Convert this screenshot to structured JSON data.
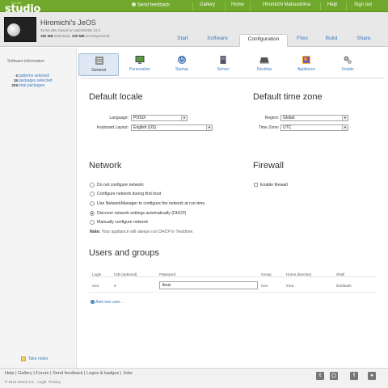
{
  "brand": {
    "small": "SUSE",
    "name": "studio"
  },
  "topnav": {
    "send_feedback": "Send feedback",
    "gallery": "Gallery",
    "home": "Home",
    "user": "Hiromichi Matsushima",
    "help": "Help",
    "sign_out": "Sign out"
  },
  "app": {
    "title": "Hiromichi's JeOS",
    "subtitle": "32-bit x86, based on openSUSE 12.2",
    "download_size": "180 MB",
    "download_label": "download,",
    "uncompressed_size": "336 MB",
    "uncompressed_label": "uncompressed"
  },
  "tabs": [
    {
      "label": "Start"
    },
    {
      "label": "Software"
    },
    {
      "label": "Configuration"
    },
    {
      "label": "Files"
    },
    {
      "label": "Build"
    },
    {
      "label": "Share"
    }
  ],
  "sidebar": {
    "title": "Software information",
    "stats": [
      {
        "num": "0",
        "label": "patterns selected"
      },
      {
        "num": "15",
        "label": "packages selected"
      },
      {
        "num": "225",
        "label": "total packages"
      }
    ],
    "take_notes": "Take notes"
  },
  "config_sections": [
    {
      "label": "General",
      "icon": "general-icon"
    },
    {
      "label": "Personalize",
      "icon": "personalize-icon"
    },
    {
      "label": "Startup",
      "icon": "startup-icon"
    },
    {
      "label": "Server",
      "icon": "server-icon"
    },
    {
      "label": "Desktop",
      "icon": "desktop-icon"
    },
    {
      "label": "Appliance",
      "icon": "appliance-icon"
    },
    {
      "label": "Scripts",
      "icon": "scripts-icon"
    }
  ],
  "locale": {
    "heading": "Default locale",
    "language_label": "Language:",
    "language_value": "POSIX",
    "keyboard_label": "Keyboard Layout:",
    "keyboard_value": "English (US)"
  },
  "timezone": {
    "heading": "Default time zone",
    "region_label": "Region:",
    "region_value": "Global",
    "tz_label": "Time Zone:",
    "tz_value": "UTC"
  },
  "network": {
    "heading": "Network",
    "options": [
      {
        "label": "Do not configure network"
      },
      {
        "label": "Configure network during first boot"
      },
      {
        "label": "Use NetworkManager to configure the network at run-time"
      },
      {
        "label": "Discover network settings automatically (DHCP)"
      },
      {
        "label": "Manually configure network"
      }
    ],
    "selected_index": 3,
    "note_label": "Note:",
    "note_text": "Your appliance will always run DHCP in Testdrive."
  },
  "firewall": {
    "heading": "Firewall",
    "enable_label": "Enable firewall"
  },
  "users": {
    "heading": "Users and groups",
    "columns": [
      "Login",
      "UID (optional)",
      "Password",
      "Group",
      "Home directory",
      "Shell"
    ],
    "rows": [
      {
        "login": "root",
        "uid": "0",
        "password": "linux",
        "group": "root",
        "home": "/root",
        "shell": "/bin/bash"
      }
    ],
    "add_label": "Add new user..."
  },
  "footer": {
    "links": [
      "Help",
      "Gallery",
      "Forum",
      "Send feedback",
      "Logos & badges",
      "Jobs"
    ],
    "copyright": "© 2013 Novell, Inc.",
    "legal": "Legal",
    "privacy": "Privacy"
  },
  "colors": {
    "topbar": "#6fa82b",
    "link": "#3a7abf",
    "header_bg": "#e8e8e8"
  }
}
